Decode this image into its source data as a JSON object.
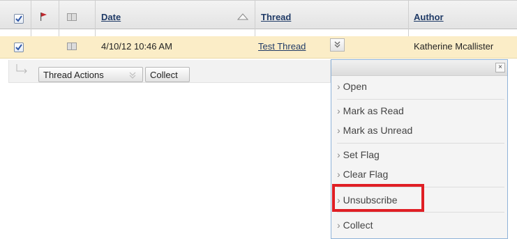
{
  "header": {
    "date_label": "Date",
    "thread_label": "Thread",
    "author_label": "Author"
  },
  "row": {
    "checked": true,
    "date": "4/10/12 10:46 AM",
    "thread": "Test Thread",
    "author": "Katherine Mcallister"
  },
  "actions": {
    "thread_actions_label": "Thread Actions",
    "collect_label": "Collect"
  },
  "menu": {
    "close_glyph": "×",
    "items": [
      {
        "label": "Open"
      },
      {
        "label": "Mark as Read"
      },
      {
        "label": "Mark as Unread"
      },
      {
        "label": "Set Flag"
      },
      {
        "label": "Clear Flag"
      },
      {
        "label": "Unsubscribe"
      },
      {
        "label": "Collect"
      }
    ]
  },
  "colors": {
    "selected_row": "#fbedc7",
    "highlight": "#e01f25",
    "link": "#1f3a66"
  }
}
